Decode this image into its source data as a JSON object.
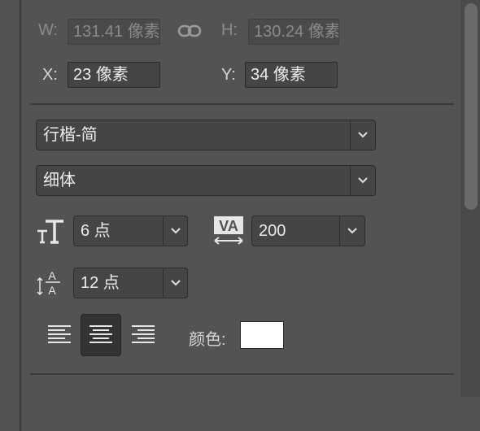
{
  "transform": {
    "w_label": "W:",
    "w_value": "131.41 像素",
    "h_label": "H:",
    "h_value": "130.24 像素",
    "x_label": "X:",
    "x_value": "23 像素",
    "y_label": "Y:",
    "y_value": "34 像素",
    "link_icon": "link-icon"
  },
  "character": {
    "font_family": "行楷-简",
    "font_style": "细体",
    "font_size": "6 点",
    "tracking": "200",
    "leading": "12 点"
  },
  "paragraph": {
    "align_options": [
      "align-left",
      "align-center",
      "align-right"
    ],
    "active_align": "align-center",
    "color_label": "颜色:",
    "color_value": "#ffffff"
  }
}
